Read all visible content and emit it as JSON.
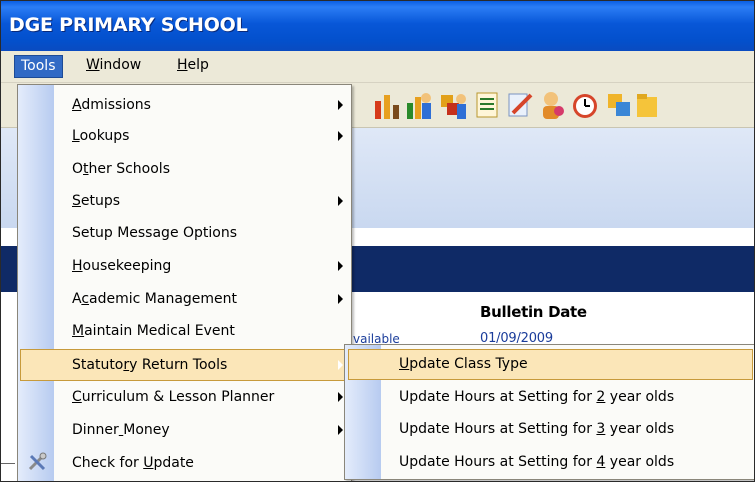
{
  "window": {
    "title": "DGE PRIMARY SCHOOL"
  },
  "menubar": [
    {
      "text": "Tools",
      "u": "T"
    },
    {
      "text": "Window",
      "u": "W"
    },
    {
      "text": "Help",
      "u": "H"
    }
  ],
  "toolbar_icons": [
    "chart-icon",
    "chart-person-icon",
    "puzzle-person-icon",
    "report-icon",
    "edit-icon",
    "user-icon",
    "clock-icon",
    "transfer-icon",
    "folder-icon"
  ],
  "content": {
    "bulletin_header": "Bulletin Date",
    "bulletin_date": "01/09/2009",
    "available_fragment": "vailable"
  },
  "tools_menu": {
    "items": [
      {
        "pre": "",
        "u": "A",
        "post": "dmissions",
        "submenu": true,
        "name": "admissions"
      },
      {
        "pre": "",
        "u": "L",
        "post": "ookups",
        "submenu": true,
        "name": "lookups"
      },
      {
        "pre": "O",
        "u": "t",
        "post": "her Schools",
        "submenu": false,
        "name": "other-schools"
      },
      {
        "pre": "",
        "u": "S",
        "post": "etups",
        "submenu": true,
        "name": "setups"
      },
      {
        "pre": "Setup Message Options",
        "u": "",
        "post": "",
        "submenu": false,
        "name": "setup-message-options"
      },
      {
        "pre": "",
        "u": "H",
        "post": "ousekeeping",
        "submenu": true,
        "name": "housekeeping"
      },
      {
        "pre": "A",
        "u": "c",
        "post": "ademic Management",
        "submenu": true,
        "name": "academic-management"
      },
      {
        "pre": "",
        "u": "M",
        "post": "aintain Medical Event",
        "submenu": false,
        "name": "maintain-medical-event"
      },
      {
        "pre": "Statuto",
        "u": "r",
        "post": "y Return Tools",
        "submenu": true,
        "selected": true,
        "name": "statutory-return-tools"
      },
      {
        "pre": "",
        "u": "C",
        "post": "urriculum & Lesson Planner",
        "submenu": true,
        "name": "curriculum-lesson-planner"
      },
      {
        "pre": "Dinner",
        "u": " ",
        "post": "Money",
        "submenu": true,
        "name": "dinner-money"
      },
      {
        "pre": "Check for ",
        "u": "U",
        "post": "pdate",
        "submenu": false,
        "icon": "tools-icon",
        "name": "check-for-update"
      }
    ]
  },
  "statutory_submenu": {
    "items": [
      {
        "pre": "",
        "u": "U",
        "post": "pdate Class Type",
        "selected": true,
        "name": "update-class-type"
      },
      {
        "pre": "Update Hours at Setting for ",
        "u": "2",
        "post": " year olds",
        "name": "update-hours-2"
      },
      {
        "pre": "Update Hours at Setting for ",
        "u": "3",
        "post": " year olds",
        "name": "update-hours-3"
      },
      {
        "pre": "Update Hours at Setting for ",
        "u": "4",
        "post": " year olds",
        "name": "update-hours-4"
      }
    ]
  }
}
